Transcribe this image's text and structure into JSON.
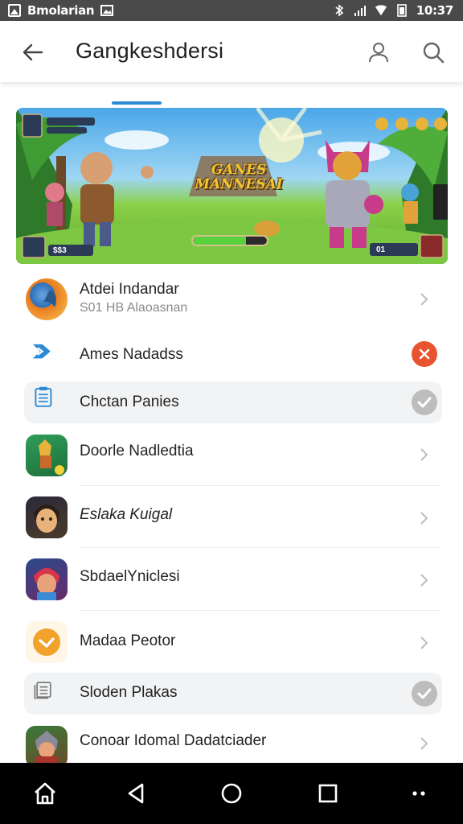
{
  "status_bar": {
    "app_name": "Bmolarian",
    "time": "10:37",
    "icons": [
      "app-icon",
      "image-icon",
      "bluetooth-icon",
      "signal-icon",
      "wifi-icon",
      "battery-icon"
    ]
  },
  "app_bar": {
    "title": "Gangkeshdersi",
    "back_icon": "arrow-left-icon",
    "account_icon": "person-icon",
    "search_icon": "search-icon"
  },
  "banner": {
    "title_line1": "GANES",
    "title_line2": "MANNESAI",
    "hud_bottom_left": "$$3",
    "hud_bottom_right": "01",
    "progress_fraction": 0.72
  },
  "list": {
    "items": [
      {
        "label": "Atdei Indandar",
        "sub": "S01 HB Alaoasnan",
        "icon": "game-logo-icon",
        "trailing": "chevron-right-icon"
      },
      {
        "label": "Ames Nadadss",
        "icon": "play-arrow-icon",
        "trailing": "close-badge-icon",
        "trailing_color": "#e8542f"
      },
      {
        "label": "Chctan Panies",
        "icon": "document-list-icon",
        "trailing": "check-badge-icon",
        "highlighted": true
      },
      {
        "label": "Doorle Nadledtia",
        "icon": "game-character-icon",
        "trailing": "chevron-right-icon"
      },
      {
        "label": "Eslaka Kuigal",
        "icon": "game-portrait-icon",
        "trailing": "chevron-right-icon"
      },
      {
        "label": "SbdaelYniclesi",
        "icon": "game-hero-icon",
        "trailing": "chevron-right-icon"
      },
      {
        "label": "Madaa Peotor",
        "icon": "orange-chevron-icon",
        "trailing": "chevron-right-icon"
      },
      {
        "label": "Sloden Plakas",
        "icon": "clipboard-icon",
        "trailing": "check-badge-icon",
        "highlighted": true
      },
      {
        "label": "Conoar Idomal Dadatciader",
        "icon": "game-warrior-icon",
        "trailing": "chevron-right-icon"
      }
    ]
  },
  "nav_bar": {
    "icons": [
      "home-icon",
      "back-triangle-icon",
      "home-circle-icon",
      "recents-square-icon",
      "more-dots-icon"
    ]
  },
  "colors": {
    "accent": "#2b8bd6",
    "close_badge": "#e8542f",
    "check_badge": "#bdbdbd",
    "status_bar": "#4a4a4a",
    "nav_bar": "#000000"
  }
}
